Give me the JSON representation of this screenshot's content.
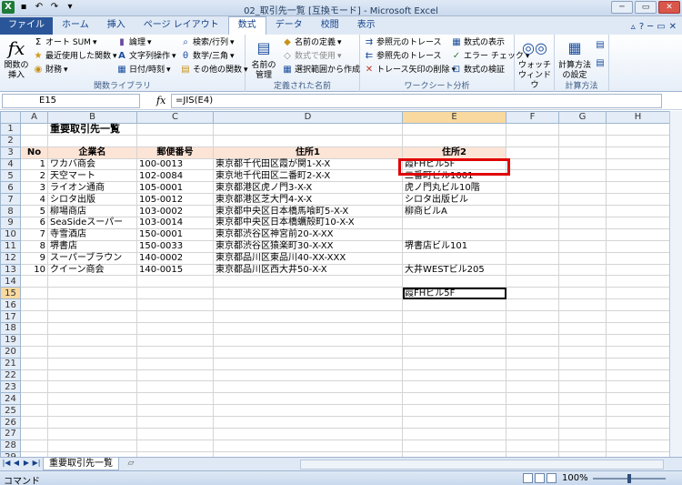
{
  "window": {
    "title": "02_取引先一覧 [互換モード] - Microsoft Excel"
  },
  "ribbon_tabs": [
    "ファイル",
    "ホーム",
    "挿入",
    "ページ レイアウト",
    "数式",
    "データ",
    "校閲",
    "表示"
  ],
  "ribbon": {
    "insert_function": "関数の\n挿入",
    "autosum": "オート SUM",
    "recent": "最近使用した関数",
    "financial": "財務",
    "logical": "論理",
    "text": "文字列操作",
    "datetime": "日付/時刻",
    "lookup": "検索/行列",
    "math": "数学/三角",
    "more": "その他の関数",
    "group_library": "関数ライブラリ",
    "name_manager": "名前の\n管理",
    "define_name": "名前の定義",
    "use_in_formula": "数式で使用",
    "create_from_selection": "選択範囲から作成",
    "group_names": "定義された名前",
    "trace_precedents": "参照元のトレース",
    "trace_dependents": "参照先のトレース",
    "remove_arrows": "トレース矢印の削除",
    "show_formulas": "数式の表示",
    "error_checking": "エラー チェック",
    "evaluate_formula": "数式の検証",
    "watch_window": "ウォッチ\nウィンドウ",
    "group_auditing": "ワークシート分析",
    "calc_options": "計算方法\nの設定",
    "group_calc": "計算方法"
  },
  "formula_bar": {
    "name_box": "E15",
    "fx": "fx",
    "formula": "=JIS(E4)"
  },
  "columns": [
    "A",
    "B",
    "C",
    "D",
    "E",
    "F",
    "G",
    "H"
  ],
  "sheet": {
    "title": "重要取引先一覧",
    "headers": [
      "No",
      "企業名",
      "郵便番号",
      "住所1",
      "住所2"
    ],
    "rows": [
      [
        "1",
        "ワカバ商会",
        "100-0013",
        "東京都千代田区霞が関1-X-X",
        "霞FHビル5F"
      ],
      [
        "2",
        "天空マート",
        "102-0084",
        "東京地千代田区二番町2-X-X",
        "二番町ビル1001"
      ],
      [
        "3",
        "ライオン通商",
        "105-0001",
        "東京都港区虎ノ門3-X-X",
        "虎ノ門丸ビル10階"
      ],
      [
        "4",
        "シロタ出版",
        "105-0012",
        "東京都港区芝大門4-X-X",
        "シロタ出版ビル"
      ],
      [
        "5",
        "柳場商店",
        "103-0002",
        "東京都中央区日本橋馬喰町5-X-X",
        "柳商ビルA"
      ],
      [
        "6",
        "SeaSideスーパー",
        "103-0014",
        "東京都中央区日本橋蠣殻町10-X-X",
        ""
      ],
      [
        "7",
        "寺雪酒店",
        "150-0001",
        "東京都渋谷区神宮前20-X-XX",
        ""
      ],
      [
        "8",
        "堺書店",
        "150-0033",
        "東京都渋谷区猿楽町30-X-XX",
        "堺書店ビル101"
      ],
      [
        "9",
        "スーパーブラウン",
        "140-0002",
        "東京都品川区東品川40-XX-XXX",
        ""
      ],
      [
        "10",
        "クイーン商会",
        "140-0015",
        "東京都品川区西大井50-X-X",
        "大井WESTビル205"
      ]
    ],
    "e15_value": "霞FHビル5F"
  },
  "sheet_tab": "重要取引先一覧",
  "status": {
    "mode": "コマンド",
    "zoom": "100%"
  }
}
